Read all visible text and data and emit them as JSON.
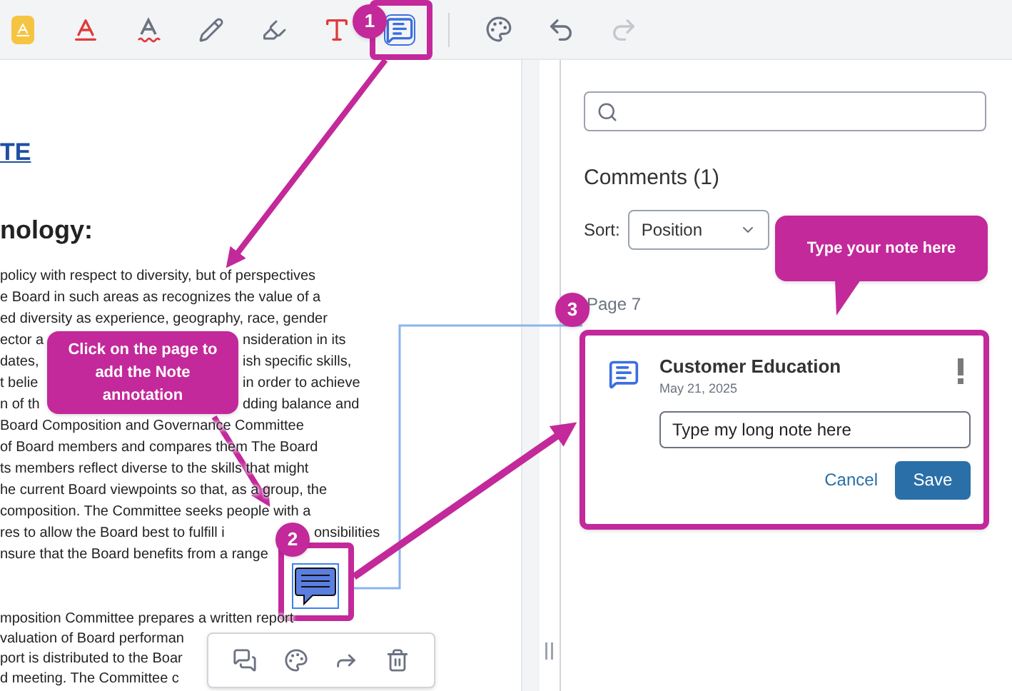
{
  "toolbar": {
    "tools": [
      {
        "kind": "free-text",
        "selected": false
      },
      {
        "kind": "underline",
        "selected": false
      },
      {
        "kind": "squiggly",
        "selected": false
      },
      {
        "kind": "pen",
        "selected": false
      },
      {
        "kind": "highlighter",
        "selected": false
      },
      {
        "kind": "text",
        "selected": false
      },
      {
        "kind": "note",
        "selected": true
      },
      {
        "kind": "color",
        "selected": false
      },
      {
        "kind": "undo",
        "selected": false
      },
      {
        "kind": "redo",
        "selected": false,
        "disabled": true
      }
    ]
  },
  "document": {
    "heading_link": "TE",
    "heading": "nology:",
    "paragraphs": [
      {
        "lines": [
          {
            "kind": "plain",
            "segments": [
              "policy with respect to diversity, but of perspectives"
            ]
          },
          {
            "kind": "plain",
            "segments": [
              "e Board in such areas as recognizes the value of a"
            ]
          },
          {
            "kind": "plain",
            "segments": [
              "ed diversity as experience, geography, race, gender"
            ]
          },
          {
            "kind": "gap_callout",
            "segments": [
              "ector a",
              "nsideration in its"
            ]
          },
          {
            "kind": "gap_callout",
            "segments": [
              "dates,",
              "ish specific skills,"
            ]
          },
          {
            "kind": "gap_callout",
            "segments": [
              "t belie",
              "in order to achieve"
            ]
          },
          {
            "kind": "gap_callout",
            "segments": [
              "n of th",
              "dding balance and"
            ]
          },
          {
            "kind": "plain",
            "segments": [
              "Board Composition and Governance Committee"
            ]
          },
          {
            "kind": "plain",
            "segments": [
              "of Board members and compares them The Board"
            ]
          },
          {
            "kind": "plain",
            "segments": [
              "ts members reflect diverse to the skills that might"
            ]
          },
          {
            "kind": "plain",
            "segments": [
              "he current Board viewpoints so that, as a group, the"
            ]
          },
          {
            "kind": "plain",
            "segments": [
              "composition. The Committee seeks people with a"
            ]
          },
          {
            "kind": "gap_badge",
            "segments": [
              "res to allow the Board best to fulfill i",
              "onsibilities"
            ]
          },
          {
            "kind": "plain",
            "segments": [
              "nsure that the Board benefits from a range"
            ]
          }
        ]
      },
      {
        "lines": [
          {
            "kind": "plain",
            "segments": [
              "mposition Committee prepares a written report"
            ]
          },
          {
            "kind": "plain",
            "segments": [
              "valuation of Board performan"
            ]
          },
          {
            "kind": "plain",
            "segments": [
              "port is distributed to the Boar"
            ]
          },
          {
            "kind": "plain",
            "segments": [
              "d meeting. The Committee c"
            ]
          }
        ]
      }
    ]
  },
  "comments_panel": {
    "title": "Comments (1)",
    "sort": {
      "label": "Sort:",
      "value": "Position"
    },
    "page_label": "Page 7",
    "comment": {
      "author": "Customer Education",
      "date": "May 21, 2025",
      "value": "Type my long note here",
      "cancel": "Cancel",
      "save": "Save"
    }
  },
  "guide": {
    "steps": [
      "1",
      "2",
      "3"
    ],
    "callouts": [
      "Click on the page to add the Note annotation",
      "Type your note here"
    ]
  }
}
